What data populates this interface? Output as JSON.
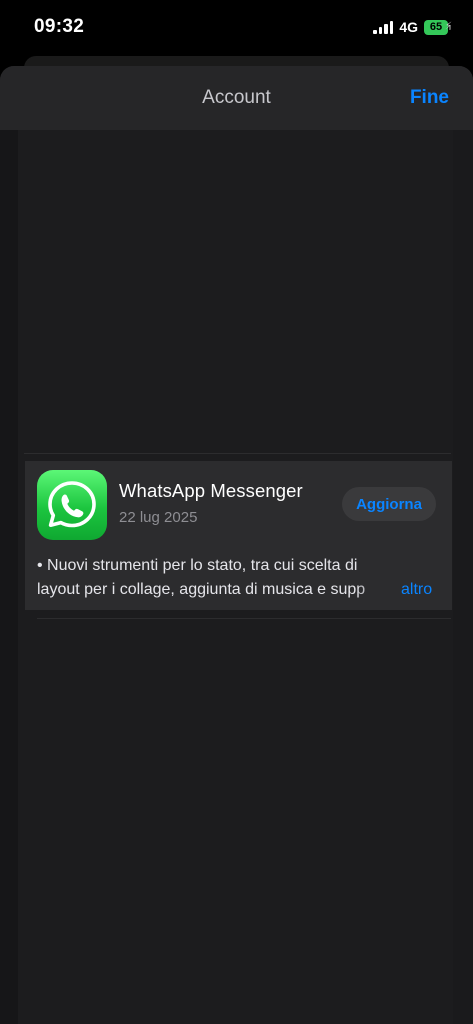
{
  "status_bar": {
    "time": "09:32",
    "network": "4G",
    "battery": "65"
  },
  "nav": {
    "title": "Account",
    "done_label": "Fine"
  },
  "update": {
    "app_name": "WhatsApp Messenger",
    "date": "22 lug 2025",
    "button_label": "Aggiorna",
    "notes_line1": "• Nuovi strumenti per lo stato, tra cui scelta di",
    "notes_line2": "layout per i collage, aggiunta di musica e supp",
    "more_label": "altro"
  },
  "colors": {
    "accent": "#0a84ff",
    "app_icon": "#25d366",
    "battery": "#34c759"
  },
  "icons": {
    "app": "whatsapp-icon",
    "signal": "signal-bars-icon",
    "battery": "battery-icon"
  }
}
